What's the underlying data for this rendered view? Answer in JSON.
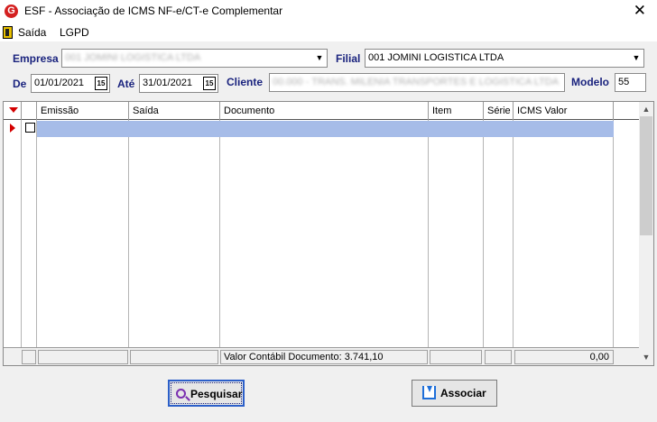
{
  "window": {
    "title": "ESF - Associação de ICMS NF-e/CT-e Complementar",
    "logo_letter": "G",
    "close_glyph": "✕"
  },
  "menu": {
    "saida": "Saída",
    "lgpd": "LGPD"
  },
  "filters": {
    "empresa_label": "Empresa",
    "empresa_value": "001 JOMINI LOGISTICA LTDA",
    "filial_label": "Filial",
    "filial_value": "001 JOMINI LOGISTICA LTDA",
    "de_label": "De",
    "de_value": "01/01/2021",
    "ate_label": "Até",
    "ate_value": "31/01/2021",
    "calendar_glyph": "15",
    "cliente_label": "Cliente",
    "cliente_value": "00.000 - TRANS. MILENIA TRANSPORTES E LOGISTICA LTDA",
    "modelo_label": "Modelo",
    "modelo_value": "55",
    "dropdown_glyph": "▼"
  },
  "grid": {
    "columns": [
      "",
      "Emissão",
      "Saída",
      "Documento",
      "Item",
      "Série",
      "ICMS Valor"
    ],
    "footer_documento": "Valor Contábil Documento: 3.741,10",
    "footer_icms": "0,00",
    "scroll_up": "▲",
    "scroll_down": "▼"
  },
  "buttons": {
    "pesquisar": "Pesquisar",
    "associar": "Associar"
  },
  "colors": {
    "label_blue": "#1a237e",
    "selection_blue": "#a6bce8",
    "accent_red": "#d40000"
  }
}
